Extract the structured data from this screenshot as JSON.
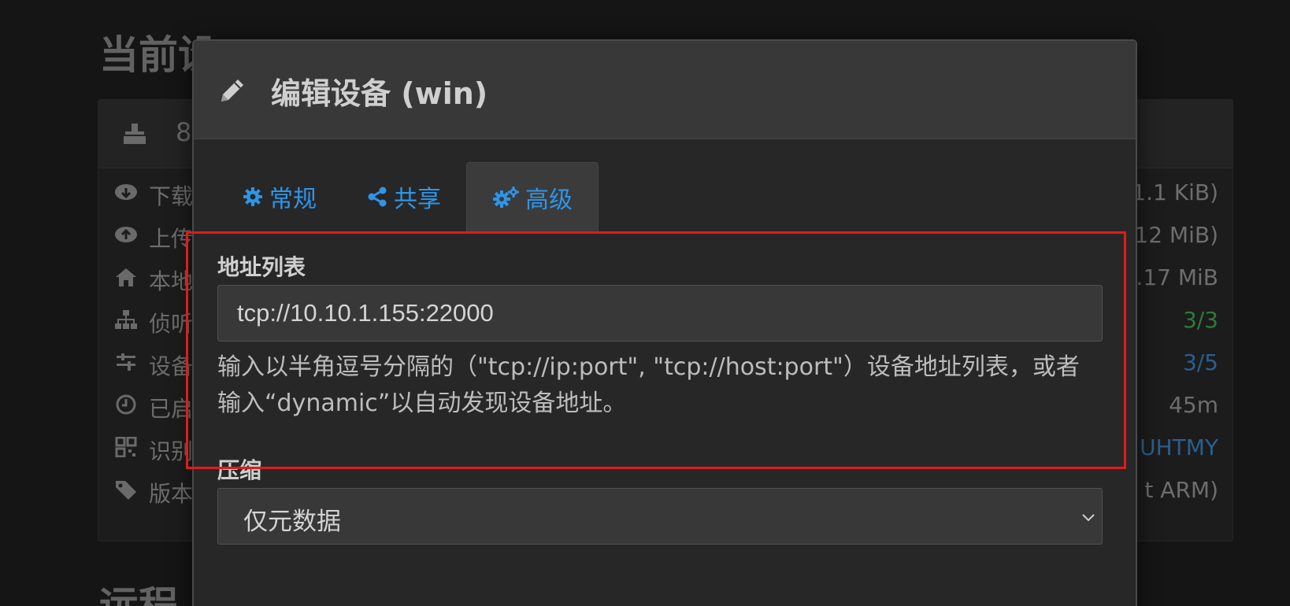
{
  "background": {
    "section_title": "当前设",
    "section_title_bottom": "远程",
    "panel_header_text": "8",
    "rows": [
      {
        "icon": "cloud-download-icon",
        "label": "下载",
        "value": "1.1 KiB)"
      },
      {
        "icon": "cloud-upload-icon",
        "label": "上传",
        "value": "12 MiB)"
      },
      {
        "icon": "home-icon",
        "label": "本地",
        "value": ".17 MiB"
      },
      {
        "icon": "sitemap-icon",
        "label": "侦听",
        "value": "3/3"
      },
      {
        "icon": "sliders-icon",
        "label": "设备",
        "value": "3/5"
      },
      {
        "icon": "clock-icon",
        "label": "已启",
        "value": "45m"
      },
      {
        "icon": "qrcode-icon",
        "label": "识别",
        "value": "UHTMY"
      },
      {
        "icon": "tag-icon",
        "label": "版本",
        "value": "t ARM)"
      }
    ],
    "colors": {
      "green": "#2f7a38",
      "blue": "#295f8d"
    }
  },
  "modal": {
    "title": "编辑设备 (win)",
    "tabs": [
      {
        "label": "常规",
        "icon": "gear-icon",
        "active": false
      },
      {
        "label": "共享",
        "icon": "share-icon",
        "active": false
      },
      {
        "label": "高级",
        "icon": "gears-icon",
        "active": true
      }
    ],
    "address_list": {
      "label": "地址列表",
      "value": "tcp://10.10.1.155:22000",
      "help": "输入以半角逗号分隔的（\"tcp://ip:port\", \"tcp://host:port\"）设备地址列表，或者输入“dynamic”以自动发现设备地址。"
    },
    "compression": {
      "label": "压缩",
      "selected": "仅元数据"
    },
    "accent_color": "#2e95e8",
    "highlight_color": "#e21a1a"
  }
}
